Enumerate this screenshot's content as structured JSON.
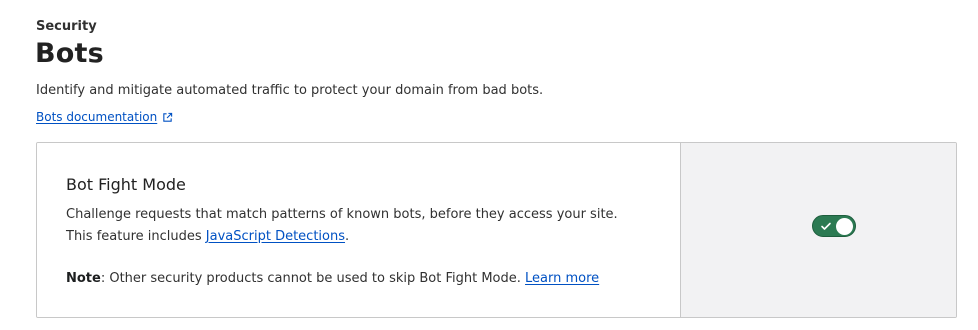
{
  "header": {
    "breadcrumb": "Security",
    "title": "Bots",
    "description": "Identify and mitigate automated traffic to protect your domain from bad bots.",
    "doc_link": "Bots documentation"
  },
  "card": {
    "title": "Bot Fight Mode",
    "description_text": "Challenge requests that match patterns of known bots, before they access your site. This feature includes ",
    "description_link": "JavaScript Detections",
    "description_end": ".",
    "note_label": "Note",
    "note_text": ": Other security products cannot be used to skip Bot Fight Mode. ",
    "note_link": "Learn more",
    "toggle": {
      "state": "on",
      "on_color": "#2c7a52"
    }
  },
  "icons": {
    "doc_link_icon": "external-link-icon",
    "toggle_icon": "check-icon"
  }
}
